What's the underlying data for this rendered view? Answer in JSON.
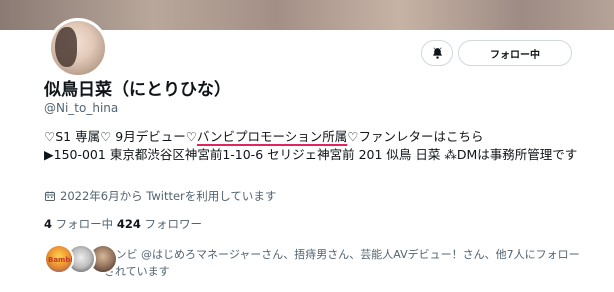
{
  "profile": {
    "name": "似鳥日菜（にとりひな）",
    "handle": "@Ni_to_hina",
    "bio_line1_a": "♡S1 専属♡ 9月デビュー♡",
    "bio_line1_link": "バンビプロモーション所属",
    "bio_line1_b": "♡ファンレターはこちら",
    "bio_line2": "▶150-001 東京都渋谷区神宮前1-10-6 セリジェ神宮前 201 似鳥 日菜 ⁂DMは事務所管理です",
    "joined": "2022年6月から Twitterを利用しています",
    "following_count": "4",
    "following_label": "フォロー中",
    "followers_count": "424",
    "followers_label": "フォロワー"
  },
  "actions": {
    "follow_label": "フォロー中",
    "bell_icon": "bell-icon"
  },
  "followed_by": {
    "text": "バンビ @はじめろマネージャーさん、捂痔男さん、芸能人AVデビュー！さん、他7人にフォローされています",
    "avatar1_label": "Bambi"
  }
}
